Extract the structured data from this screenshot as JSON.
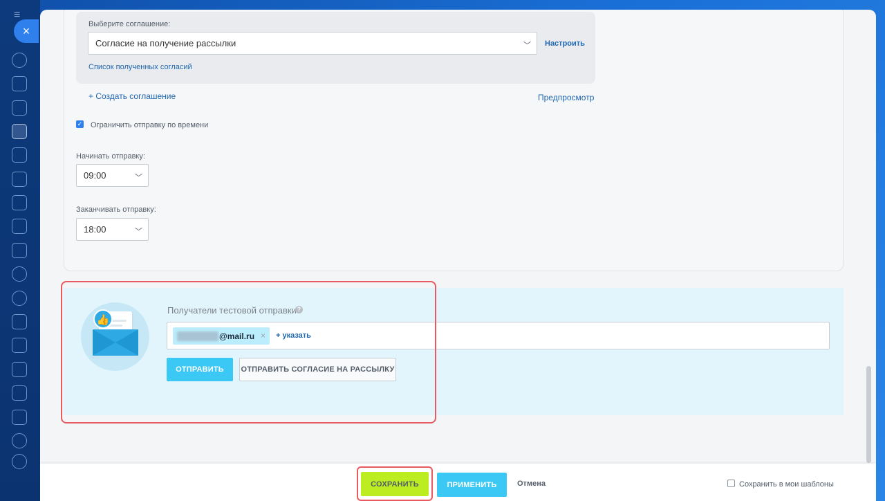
{
  "agreement": {
    "select_label": "Выберите соглашение:",
    "selected": "Согласие на получение рассылки",
    "configure_link": "Настроить",
    "list_link": "Список полученных согласий",
    "create_link": "+ Создать соглашение",
    "preview_link": "Предпросмотр"
  },
  "schedule": {
    "limit_checkbox_label": "Ограничить отправку по времени",
    "limit_checked": true,
    "start_label": "Начинать отправку:",
    "start_value": "09:00",
    "end_label": "Заканчивать отправку:",
    "end_value": "18:00"
  },
  "test_send": {
    "title": "Получатели тестовой отправки",
    "help_icon": "?",
    "recipient_email_suffix": "@mail.ru",
    "remove_icon": "×",
    "add_link": "указать",
    "send_button": "Отправить",
    "send_consent_button": "Отправить согласие на рассылку"
  },
  "footer": {
    "save_button": "Сохранить",
    "apply_button": "Применить",
    "cancel_button": "Отмена",
    "save_template_label": "Сохранить в мои шаблоны",
    "save_template_checked": false
  },
  "sidebar": {
    "close_icon": "×",
    "menu_icon": "≡"
  },
  "colors": {
    "accent_blue": "#3bc8f5",
    "save_lime": "#bbed21",
    "highlight_red": "#e85a5f",
    "link_blue": "#2067b0"
  }
}
